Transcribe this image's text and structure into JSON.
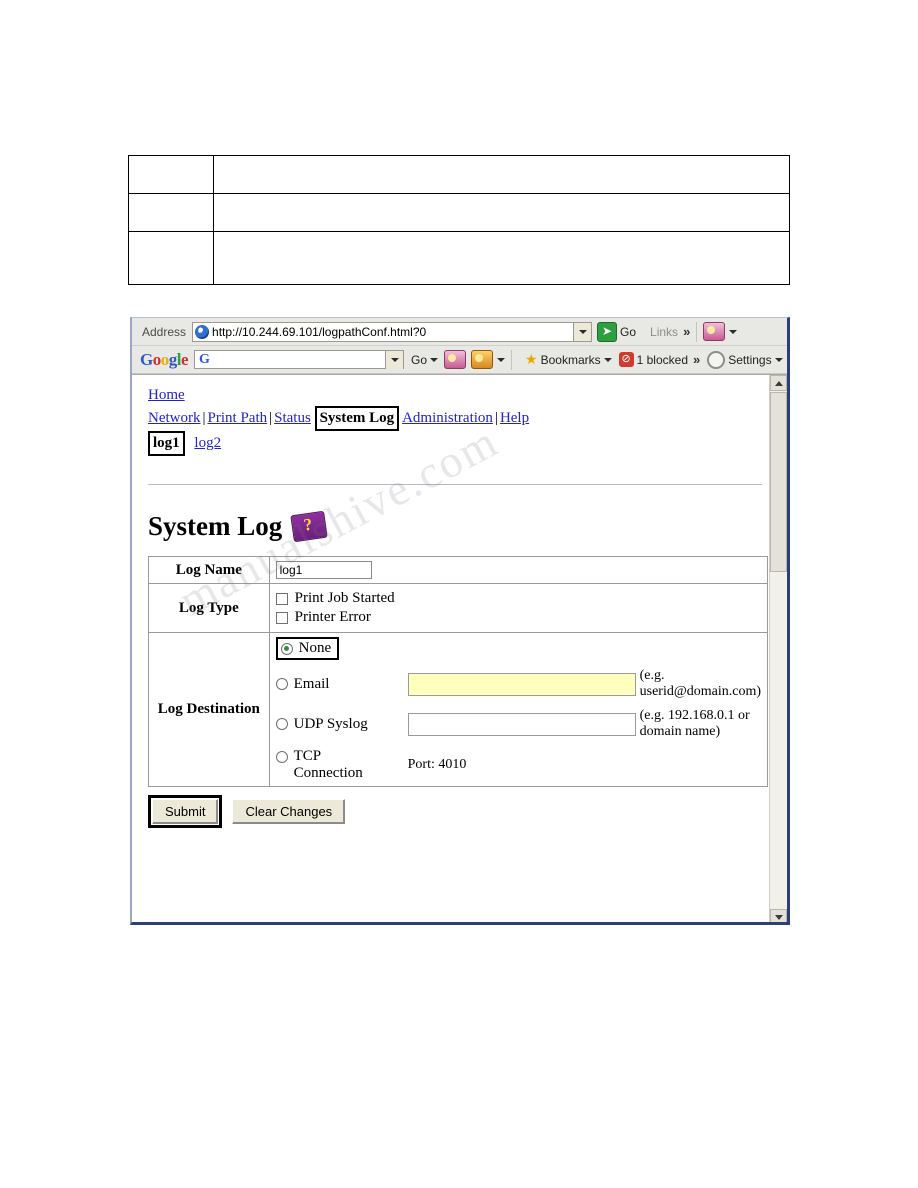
{
  "watermark": "manualshive.com",
  "doc_table": {
    "rows": [
      {
        "col_a": "",
        "col_b": ""
      },
      {
        "col_a": "",
        "col_b": ""
      },
      {
        "col_a": "",
        "col_b": ""
      }
    ]
  },
  "browser": {
    "address_bar": {
      "label": "Address",
      "url": "http://10.244.69.101/logpathConf.html?0",
      "go_label": "Go",
      "links_label": "Links",
      "chevron": "»"
    },
    "google_toolbar": {
      "brand": {
        "g1": "G",
        "o1": "o",
        "o2": "o",
        "g2": "g",
        "l": "l",
        "e": "e"
      },
      "search_value": "",
      "search_mark": "G",
      "go_label": "Go",
      "bookmarks_label": "Bookmarks",
      "blocked_label": "1 blocked",
      "blocked_icon_text": "⊘",
      "chevron": "»",
      "settings_label": "Settings",
      "caret": "▾"
    }
  },
  "nav": {
    "line1": [
      {
        "label": "Home",
        "type": "link"
      }
    ],
    "line2": [
      {
        "label": "Network",
        "type": "link"
      },
      {
        "label": "|",
        "type": "sep"
      },
      {
        "label": "Print Path",
        "type": "link"
      },
      {
        "label": "|",
        "type": "sep"
      },
      {
        "label": "Status",
        "type": "link"
      },
      {
        "label": "System Log",
        "type": "boxed"
      },
      {
        "label": "Administration",
        "type": "link"
      },
      {
        "label": "|",
        "type": "sep"
      },
      {
        "label": "Help",
        "type": "link"
      }
    ],
    "line3": [
      {
        "label": "log1",
        "type": "boxed"
      },
      {
        "label": "log2",
        "type": "link"
      }
    ]
  },
  "page": {
    "title": "System Log",
    "help_icon": "help-book-icon",
    "form": {
      "log_name": {
        "label": "Log Name",
        "value": "log1"
      },
      "log_type": {
        "label": "Log Type",
        "options": [
          {
            "label": "Print Job Started",
            "checked": false
          },
          {
            "label": "Printer Error",
            "checked": false
          }
        ]
      },
      "log_destination": {
        "label": "Log Destination",
        "options": [
          {
            "label": "None",
            "selected": true,
            "highlighted": true,
            "input": null,
            "hint": ""
          },
          {
            "label": "Email",
            "selected": false,
            "highlighted": false,
            "input": "",
            "hint": "(e.g. userid@domain.com)"
          },
          {
            "label": "UDP Syslog",
            "selected": false,
            "highlighted": false,
            "input": "",
            "hint": "(e.g. 192.168.0.1 or domain name)"
          },
          {
            "label": "TCP Connection",
            "selected": false,
            "highlighted": false,
            "input": null,
            "hint": "Port: 4010"
          }
        ]
      }
    },
    "buttons": {
      "submit": "Submit",
      "clear": "Clear Changes"
    }
  }
}
